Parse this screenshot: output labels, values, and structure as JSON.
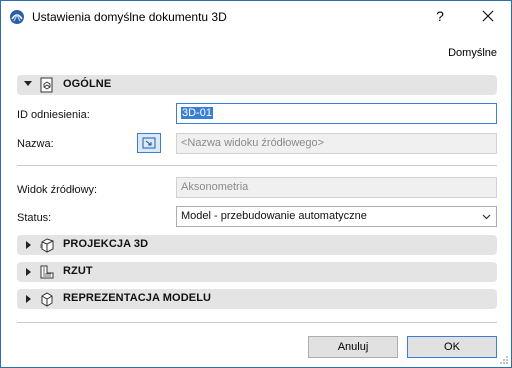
{
  "window": {
    "title": "Ustawienia domyślne dokumentu 3D",
    "help_glyph": "?",
    "preset_label": "Domyślne"
  },
  "sections": {
    "general": {
      "title": "OGÓLNE",
      "expanded": true,
      "icon": "document-3d-icon"
    },
    "projection": {
      "title": "PROJEKCJA 3D",
      "expanded": false,
      "icon": "cube-projection-icon"
    },
    "plan": {
      "title": "RZUT",
      "expanded": false,
      "icon": "floor-plan-icon"
    },
    "model": {
      "title": "REPREZENTACJA MODELU",
      "expanded": false,
      "icon": "cube-model-icon"
    }
  },
  "fields": {
    "ref_id_label": "ID odniesienia:",
    "ref_id_value": "3D-01",
    "name_label": "Nazwa:",
    "name_placeholder": "<Nazwa widoku źródłowego>",
    "source_view_label": "Widok źródłowy:",
    "source_view_value": "Aksonometria",
    "status_label": "Status:",
    "status_value": "Model - przebudowanie automatyczne"
  },
  "buttons": {
    "cancel": "Anuluj",
    "ok": "OK"
  },
  "colors": {
    "accent": "#3a7fd5",
    "section_bg": "#e4e4e4",
    "window_border": "#2b6dad"
  }
}
